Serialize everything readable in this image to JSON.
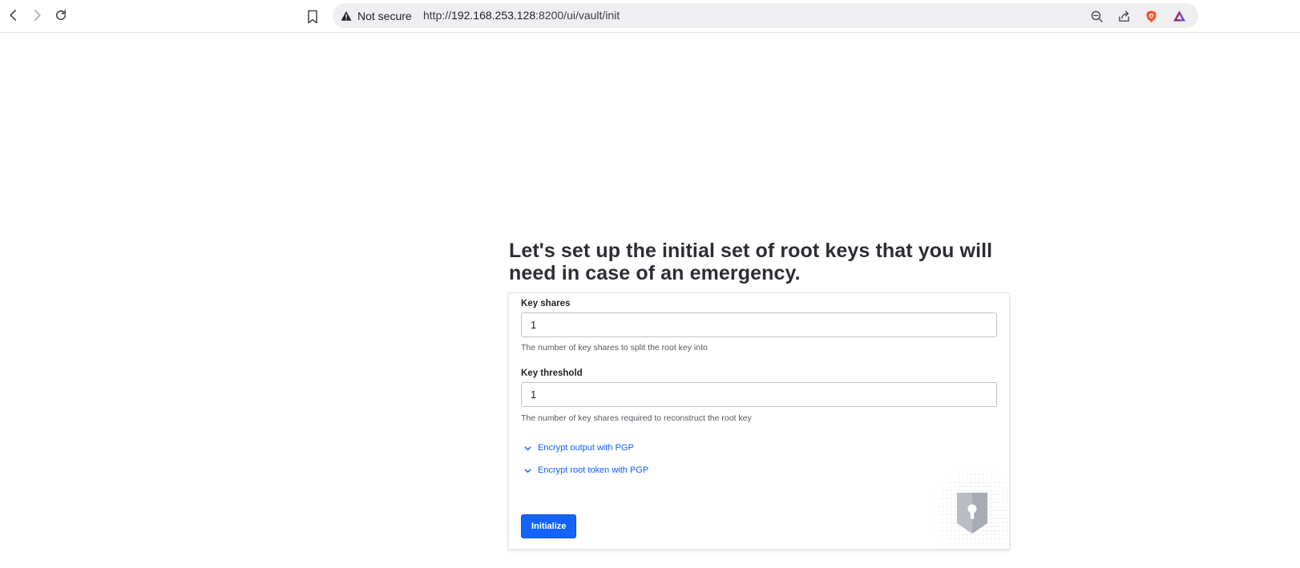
{
  "browser": {
    "security_label": "Not secure",
    "url_prefix": "http://",
    "url_host": "192.168.253.128",
    "url_rest": ":8200/ui/vault/init"
  },
  "icons": {
    "back": "chevron-left-icon",
    "forward": "chevron-right-icon",
    "reload": "reload-icon",
    "bookmark": "bookmark-icon",
    "warning": "warning-triangle-icon",
    "zoom": "zoom-out-icon",
    "share": "share-icon",
    "brave": "brave-shields-icon",
    "rewards": "brave-rewards-icon"
  },
  "init": {
    "title": "Let's set up the initial set of root keys that you will need in case of an emergency.",
    "key_shares": {
      "label": "Key shares",
      "value": "1",
      "help": "The number of key shares to split the root key into"
    },
    "key_threshold": {
      "label": "Key threshold",
      "value": "1",
      "help": "The number of key shares required to reconstruct the root key"
    },
    "toggles": [
      {
        "label": "Encrypt output with PGP"
      },
      {
        "label": "Encrypt root token with PGP"
      }
    ],
    "submit_label": "Initialize"
  },
  "colors": {
    "accent": "#1563ff",
    "link": "#1060ff",
    "warning": "#1f2124",
    "brave": "#fb542b"
  }
}
